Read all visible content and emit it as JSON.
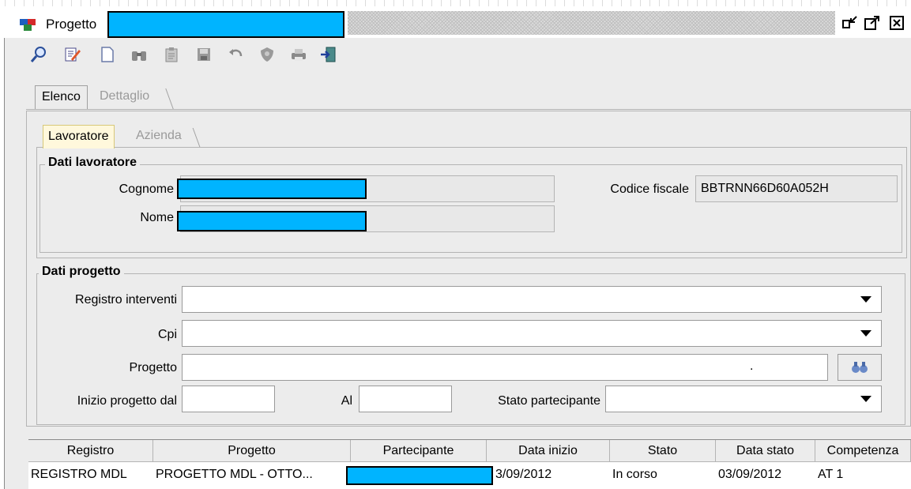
{
  "window": {
    "title": "Progetto"
  },
  "toolbar": {
    "icons": [
      "search-icon",
      "edit-icon",
      "new-document-icon",
      "binoculars-icon",
      "paste-icon",
      "save-icon",
      "undo-icon",
      "shield-icon",
      "print-icon",
      "exit-icon"
    ]
  },
  "tabs": {
    "elenco": "Elenco",
    "dettaglio": "Dettaglio"
  },
  "inner_tabs": {
    "lavoratore": "Lavoratore",
    "azienda": "Azienda"
  },
  "dati_lavoratore": {
    "legend": "Dati lavoratore",
    "cognome_label": "Cognome",
    "nome_label": "Nome",
    "codice_fiscale_label": "Codice fiscale",
    "codice_fiscale_value": "BBTRNN66D60A052H"
  },
  "dati_progetto": {
    "legend": "Dati progetto",
    "registro_label": "Registro interventi",
    "cpi_label": "Cpi",
    "progetto_label": "Progetto",
    "progetto_value": ".",
    "inizio_label": "Inizio progetto dal",
    "al_label": "Al",
    "stato_label": "Stato partecipante"
  },
  "table": {
    "columns": [
      "Registro",
      "Progetto",
      "Partecipante",
      "Data inizio",
      "Stato",
      "Data stato",
      "Competenza"
    ],
    "rows": [
      {
        "registro": "REGISTRO MDL",
        "progetto": "PROGETTO MDL - OTTO...",
        "partecipante": "",
        "data_inizio": "3/09/2012",
        "stato": "In corso",
        "data_stato": "03/09/2012",
        "competenza": "AT 1"
      }
    ]
  },
  "colors": {
    "redaction": "#00b4ff",
    "panel": "#ececec"
  }
}
